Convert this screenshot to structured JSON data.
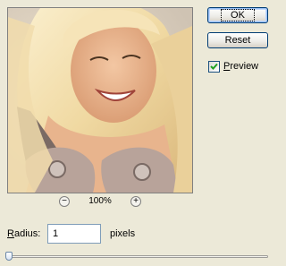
{
  "buttons": {
    "ok": "OK",
    "reset": "Reset"
  },
  "preview_checkbox": {
    "label": "Preview",
    "checked": true
  },
  "zoom": {
    "value": "100%",
    "zoom_out_icon": "minus-circle-icon",
    "zoom_in_icon": "plus-circle-icon"
  },
  "radius": {
    "label": "Radius:",
    "value": "1",
    "units": "pixels",
    "slider_fraction": 0.0
  },
  "colors": {
    "dialog_bg": "#ece9d8",
    "button_border": "#003c74",
    "default_focus": "#99c0f5",
    "input_border": "#7f9db9"
  }
}
